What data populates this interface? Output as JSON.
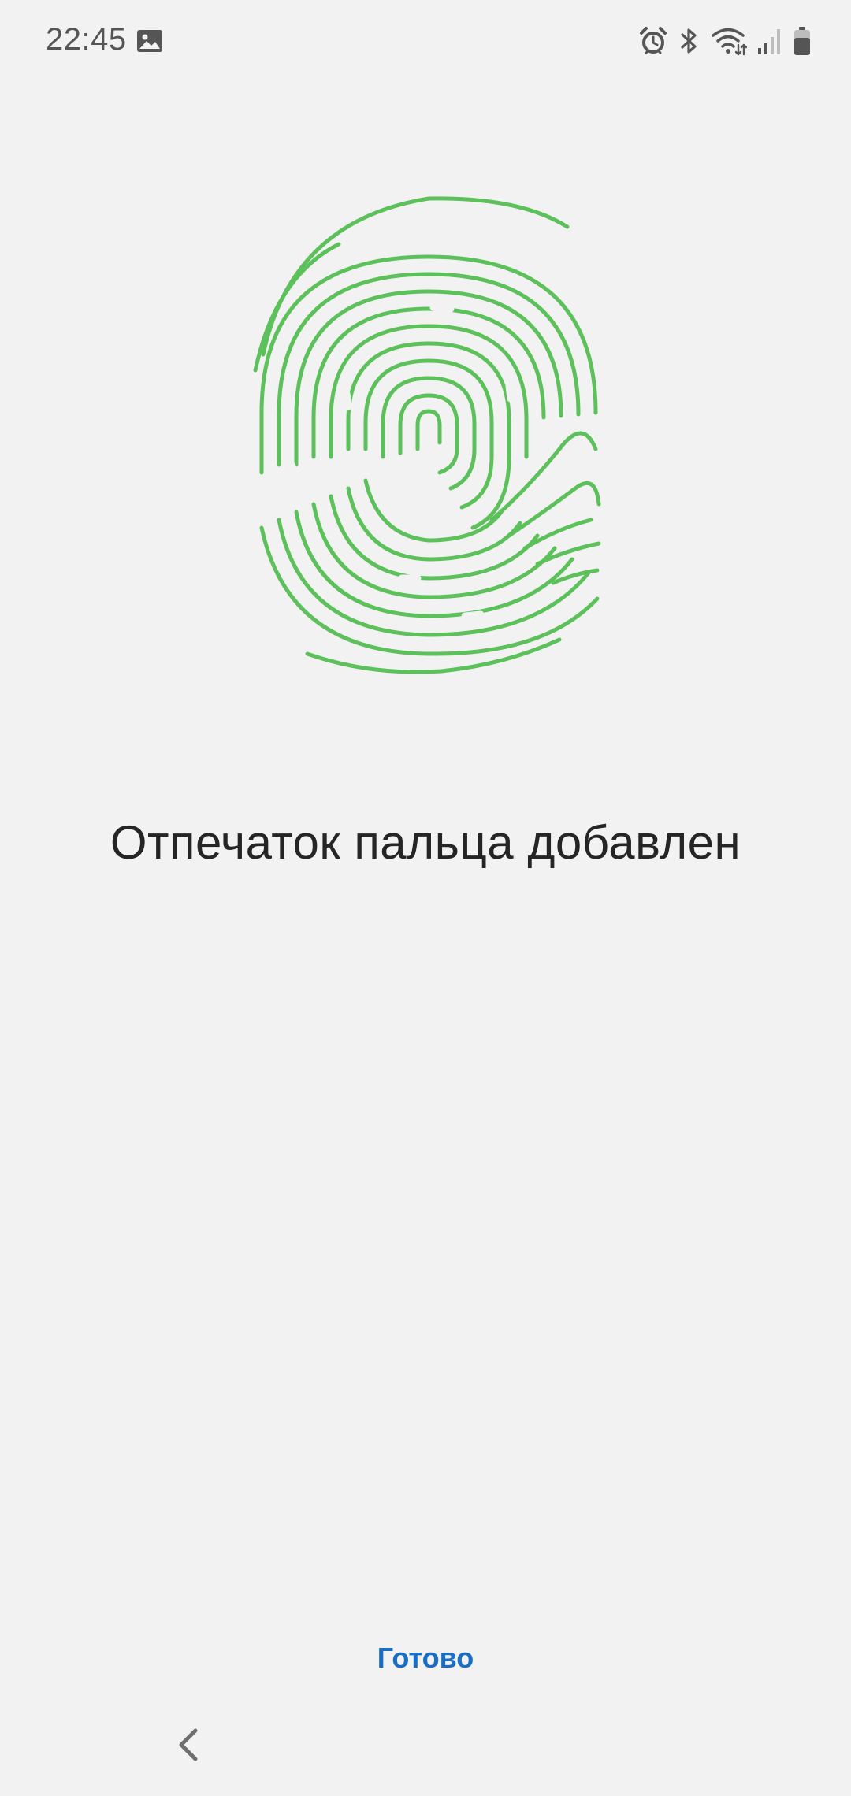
{
  "status_bar": {
    "time": "22:45",
    "icons": [
      "gallery-icon",
      "alarm-icon",
      "bluetooth-icon",
      "wifi-icon",
      "signal-icon",
      "battery-icon"
    ],
    "icon_color": "#555555"
  },
  "fingerprint": {
    "icon": "fingerprint-icon",
    "color": "#5cc15a"
  },
  "main": {
    "title": "Отпечаток пальца добавлен"
  },
  "actions": {
    "done_label": "Готово",
    "done_color": "#1a6fc4"
  },
  "navigation": {
    "back_icon": "chevron-left-icon"
  }
}
